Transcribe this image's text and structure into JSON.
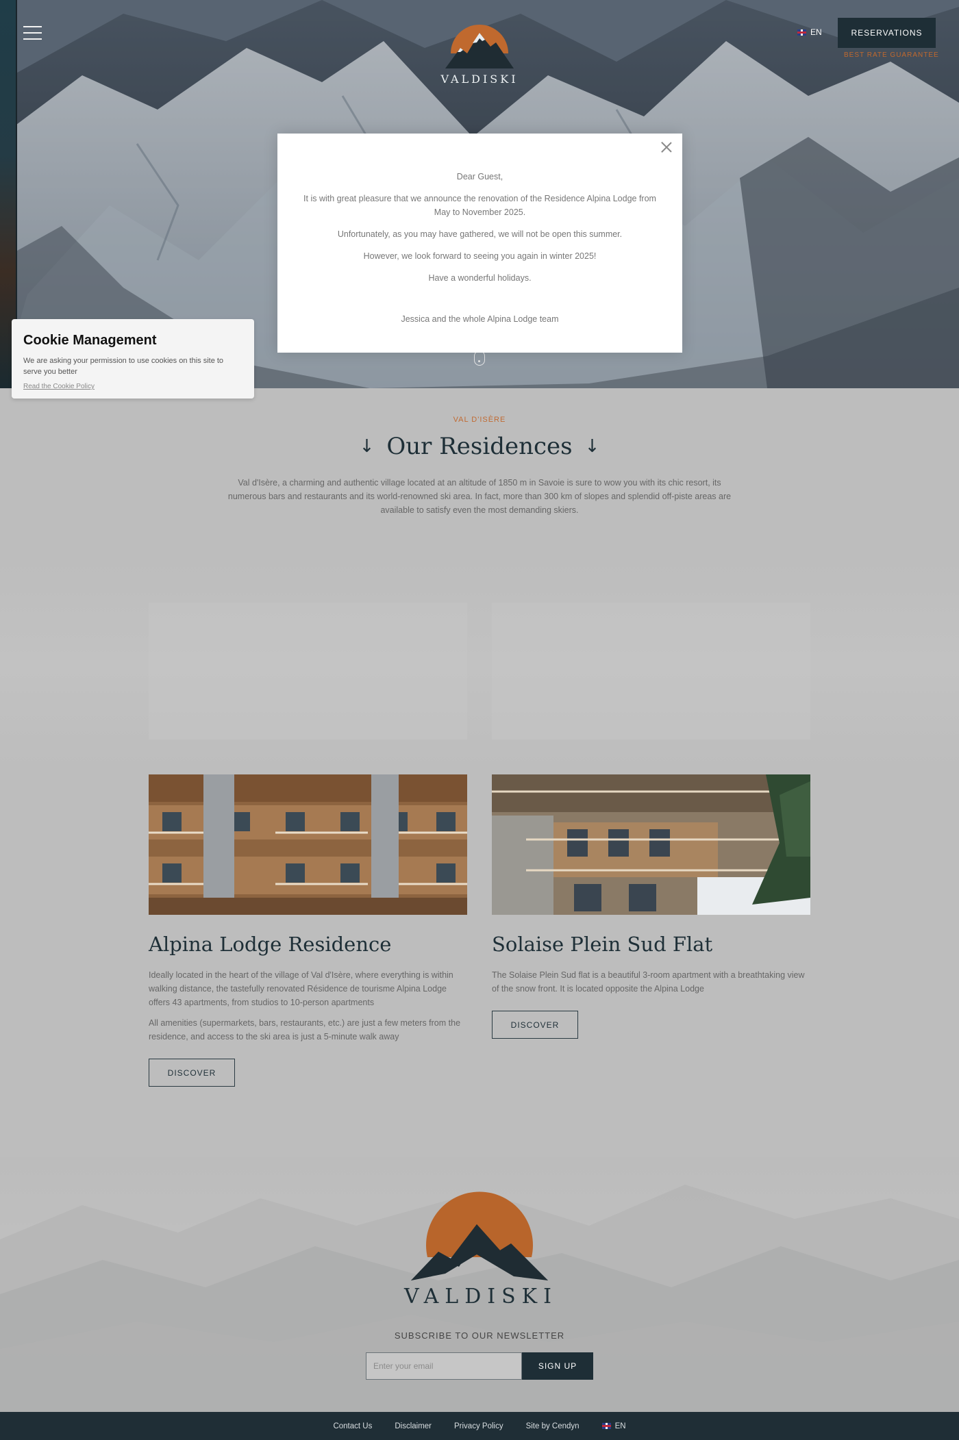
{
  "header": {
    "brand": "VALDISKI",
    "lang": "EN",
    "reservations_label": "RESERVATIONS",
    "best_rate": "BEST RATE GUARANTEE"
  },
  "modal": {
    "greeting": "Dear Guest,",
    "p1": "It is with great pleasure that we announce the renovation of the Residence Alpina Lodge from May to November 2025.",
    "p2": "Unfortunately, as you may have gathered, we will not be open this summer.",
    "p3": "However, we look forward to seeing you again in winter 2025!",
    "p4": "Have a wonderful holidays.",
    "signature": "Jessica and the whole Alpina Lodge team"
  },
  "cookie": {
    "title": "Cookie Management",
    "text": "We are asking your permission to use cookies on this site to serve you better",
    "link": "Read the Cookie Policy"
  },
  "intro": {
    "kicker": "VAL D'ISÈRE",
    "title": "Our Residences",
    "arrow": "↓",
    "text": "Val d'Isère, a charming and authentic village located at an altitude of 1850 m in Savoie is sure to wow you with its chic resort, its numerous bars and restaurants and its world-renowned ski area. In fact, more than 300 km of slopes and splendid off-piste areas are available to satisfy even the most demanding skiers."
  },
  "cards": [
    {
      "title": "Alpina Lodge Residence",
      "p1": "Ideally located in the heart of the village of Val d'Isère, where everything is within walking distance, the tastefully renovated Résidence de tourisme Alpina Lodge offers 43 apartments, from studios to 10-person apartments",
      "p2": "All amenities (supermarkets, bars, restaurants, etc.) are just a few meters from the residence, and access to the ski area is just a 5-minute walk away",
      "button": "DISCOVER"
    },
    {
      "title": "Solaise Plein Sud Flat",
      "p1": "The Solaise Plein Sud flat is a beautiful 3-room apartment with a breathtaking view of the snow front. It is located opposite the Alpina Lodge",
      "button": "DISCOVER"
    }
  ],
  "footer": {
    "brand": "VALDISKI",
    "newsletter_label": "SUBSCRIBE TO OUR NEWSLETTER",
    "email_placeholder": "Enter your email",
    "signup_label": "SIGN UP",
    "links": [
      "Contact Us",
      "Disclaimer",
      "Privacy Policy",
      "Site by Cendyn"
    ],
    "lang": "EN"
  },
  "colors": {
    "accent_orange": "#c0692e",
    "dark_navy": "#1e2e36"
  }
}
